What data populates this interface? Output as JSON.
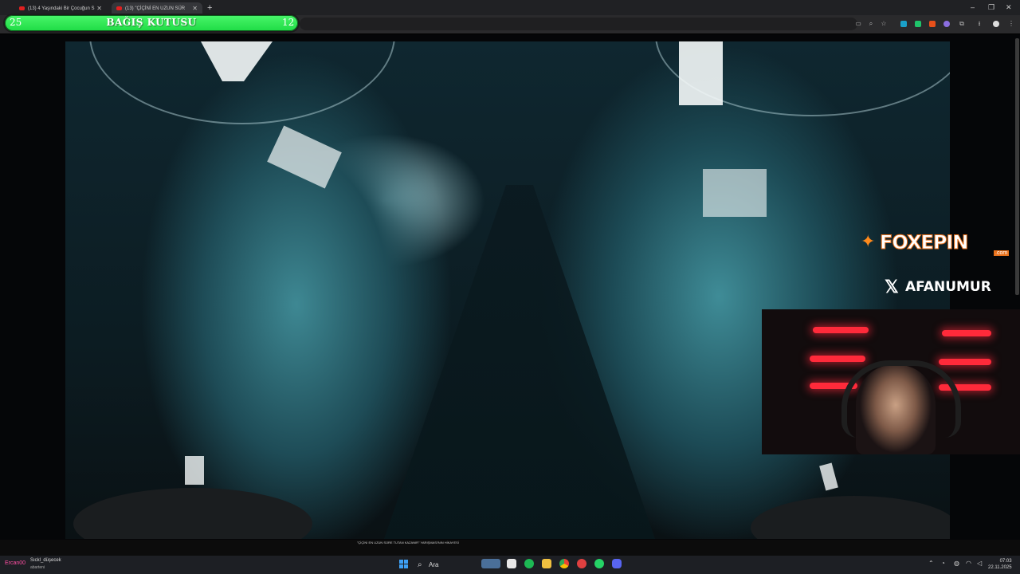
{
  "browser": {
    "tabs": [
      {
        "label": "(13) 4 Yaşındaki Bir Çocuğun S"
      },
      {
        "label": "(13) \"ÇİÇİNİ EN UZUN SÜR"
      }
    ],
    "new_tab": "+",
    "window_controls": {
      "minimize": "–",
      "restore": "❐",
      "close": "✕"
    }
  },
  "donation_bar": {
    "title": "BAĞIŞ KUTUSU",
    "left_value": "25",
    "right_value": "12",
    "progress": 1.0,
    "fill_color": "#2fe453"
  },
  "overlays": {
    "sponsor": {
      "name": "FOXEPIN",
      "suffix": ".com",
      "accent": "#e8701a"
    },
    "social": {
      "handle": "AFANUMUR"
    }
  },
  "bottom": {
    "mini_video_title": "\"ÇİÇİNİ EN UZUN SÜRE TUTAN KAZANIR\" YARIŞMASI'NIN HİKAYESİ"
  },
  "chat": {
    "user": "Ercan00",
    "message": "Sıckl_düşecek",
    "sub": "abarteni"
  },
  "taskbar": {
    "search_label": "Ara",
    "time": "07:03",
    "date": "22.11.2025"
  }
}
